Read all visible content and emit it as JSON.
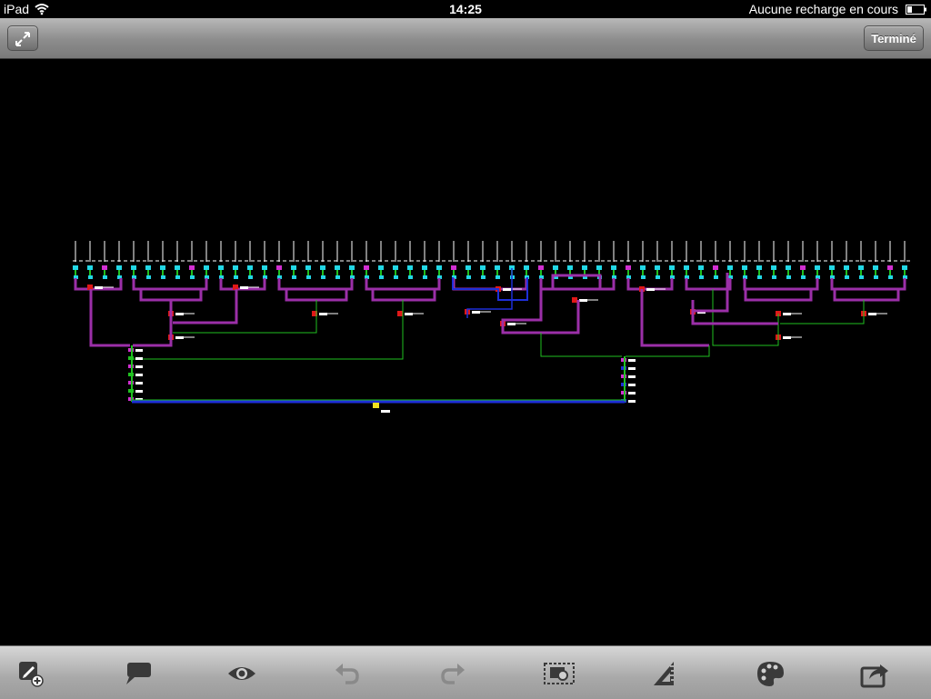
{
  "status_bar": {
    "carrier": "iPad",
    "time": "14:25",
    "charge_status": "Aucune recharge en cours"
  },
  "top_bar": {
    "done_label": "Terminé",
    "left_icon": "expand-icon"
  },
  "bottom_toolbar": {
    "tools": [
      "edit-add-icon",
      "comment-icon",
      "view-eye-icon",
      "undo-icon",
      "redo-icon",
      "select-region-icon",
      "measure-icon",
      "palette-icon",
      "share-icon"
    ]
  },
  "colors": {
    "canvas_background": "#000000",
    "trunk": "#9b2fa8",
    "branch_green": "#20c020",
    "node_cyan": "#22d7e6",
    "node_red": "#e01818",
    "main_bus": "#1e2fd8",
    "tick_white": "#ffffff"
  }
}
